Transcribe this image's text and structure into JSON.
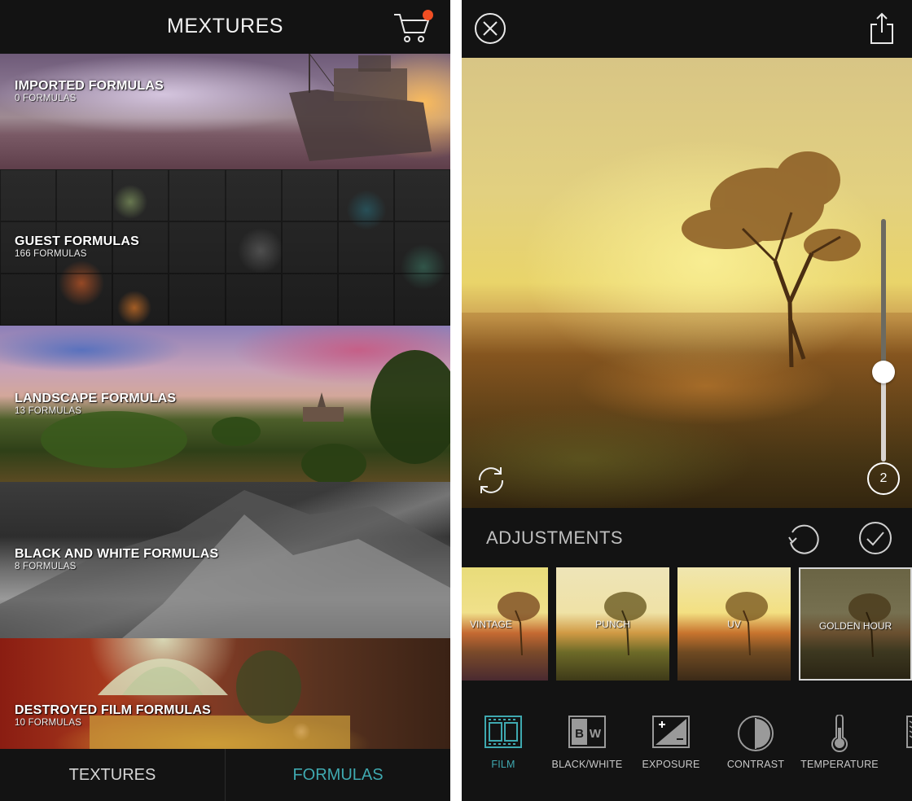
{
  "left_panel": {
    "title": "MEXTURES",
    "cart_badge_color": "#f04e23",
    "categories": [
      {
        "name": "IMPORTED FORMULAS",
        "count": "0 FORMULAS"
      },
      {
        "name": "GUEST FORMULAS",
        "count": "166 FORMULAS"
      },
      {
        "name": "LANDSCAPE FORMULAS",
        "count": "13 FORMULAS"
      },
      {
        "name": "BLACK AND WHITE FORMULAS",
        "count": "8 FORMULAS"
      },
      {
        "name": "DESTROYED FILM FORMULAS",
        "count": "10 FORMULAS"
      }
    ],
    "tabs": [
      {
        "label": "TEXTURES",
        "active": false
      },
      {
        "label": "FORMULAS",
        "active": true
      }
    ],
    "active_tab_color": "#3fa9b0"
  },
  "right_panel": {
    "icons": {
      "close": "close-circle-icon",
      "share": "share-icon",
      "rotate": "rotate-icon",
      "undo": "undo-icon",
      "confirm": "checkmark-icon"
    },
    "slider_value_percent": 37,
    "layer_count": "2",
    "adjustments_title": "ADJUSTMENTS",
    "presets": [
      {
        "label": "VINTAGE",
        "selected": false
      },
      {
        "label": "PUNCH",
        "selected": false
      },
      {
        "label": "UV",
        "selected": false
      },
      {
        "label": "GOLDEN HOUR",
        "selected": true
      }
    ],
    "tools": [
      {
        "label": "FILM",
        "icon": "film-icon",
        "active": true
      },
      {
        "label": "BLACK/WHITE",
        "icon": "black-white-icon",
        "active": false
      },
      {
        "label": "EXPOSURE",
        "icon": "exposure-icon",
        "active": false
      },
      {
        "label": "CONTRAST",
        "icon": "contrast-icon",
        "active": false
      },
      {
        "label": "TEMPERATURE",
        "icon": "temperature-icon",
        "active": false
      }
    ],
    "accent_color": "#3fa9b0"
  }
}
